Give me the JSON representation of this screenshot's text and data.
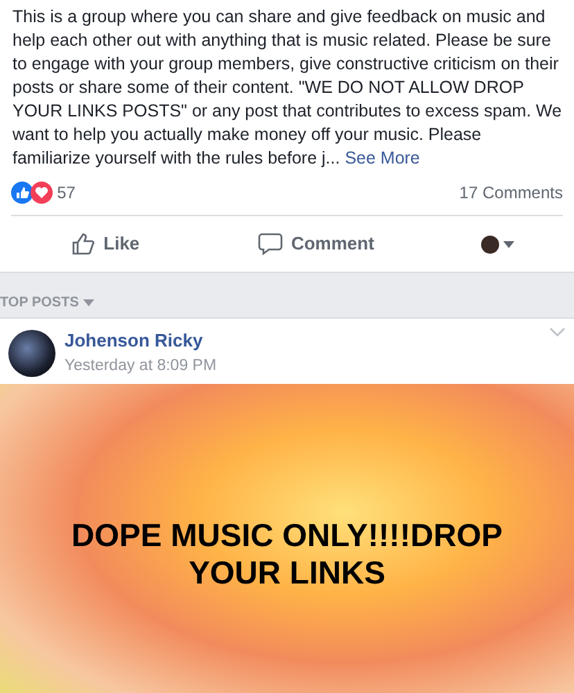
{
  "description": {
    "text": "This is a group where you can share and give feedback on music and help each other out with anything that is music related. Please be sure to engage with your group members, give constructive criticism on their posts or share some of their content. \"WE DO NOT ALLOW DROP YOUR LINKS POSTS\" or any post that contributes to excess spam. We want to help you actually make money off your music. Please familiarize yourself with the rules before j...",
    "link": "See More"
  },
  "reactions": {
    "count": "57",
    "comments": "17 Comments"
  },
  "actions": [
    {
      "label": "Like"
    },
    {
      "label": "Comment"
    }
  ],
  "section": {
    "title": "TOP POSTS"
  },
  "post": {
    "author": "Johenson Ricky",
    "time": "Yesterday at 8:09 PM",
    "text": "DOPE MUSIC ONLY!!!!DROP YOUR LINKS"
  }
}
